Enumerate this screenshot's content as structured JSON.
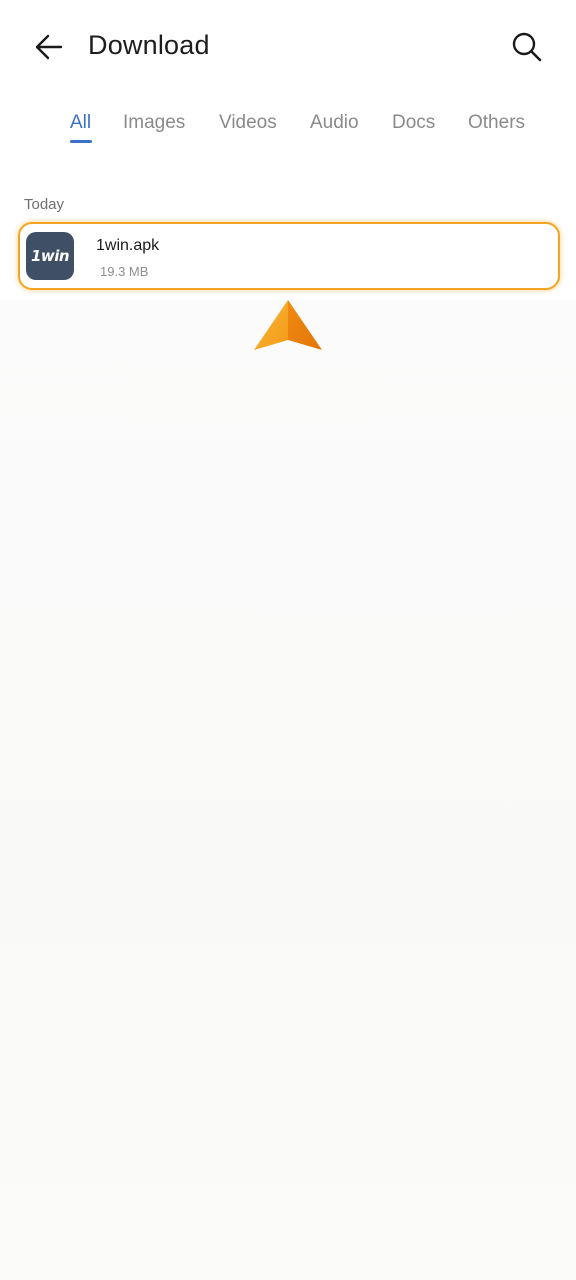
{
  "header": {
    "title": "Download",
    "back_icon": "arrow-left-icon",
    "search_icon": "search-icon"
  },
  "tabs": [
    {
      "label": "All",
      "active": true
    },
    {
      "label": "Images",
      "active": false
    },
    {
      "label": "Videos",
      "active": false
    },
    {
      "label": "Audio",
      "active": false
    },
    {
      "label": "Docs",
      "active": false
    },
    {
      "label": "Others",
      "active": false
    }
  ],
  "section": {
    "label": "Today"
  },
  "files": [
    {
      "icon_text": "1win",
      "name": "1win.apk",
      "size": "19.3 MB"
    }
  ],
  "colors": {
    "accent": "#3a72c8",
    "highlight": "#f3a521",
    "icon_bg": "#3f4f66"
  }
}
